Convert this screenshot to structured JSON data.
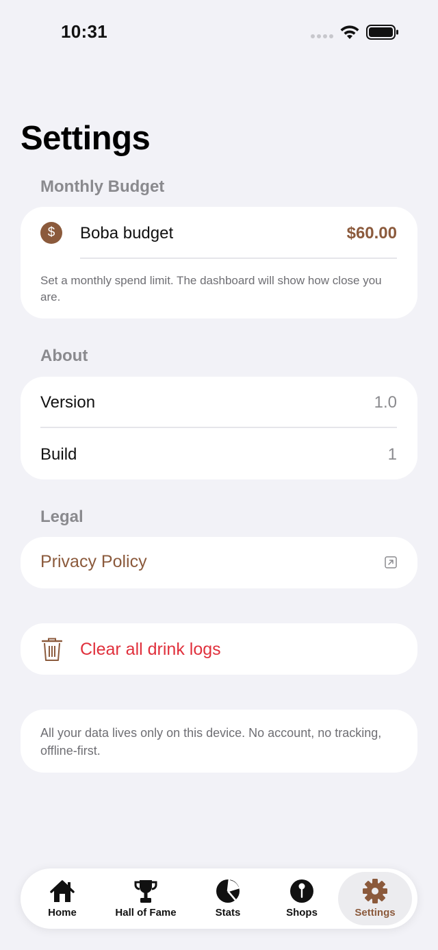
{
  "status_bar": {
    "time": "10:31"
  },
  "page": {
    "title": "Settings"
  },
  "monthly_budget": {
    "header": "Monthly Budget",
    "icon_glyph": "$",
    "label": "Boba budget",
    "value": "$60.00",
    "footnote": "Set a monthly spend limit. The dashboard will show how close you are."
  },
  "about": {
    "header": "About",
    "rows": [
      {
        "label": "Version",
        "value": "1.0"
      },
      {
        "label": "Build",
        "value": "1"
      }
    ]
  },
  "legal": {
    "header": "Legal",
    "privacy_label": "Privacy Policy"
  },
  "danger": {
    "clear_label": "Clear all drink logs"
  },
  "info": {
    "text": "All your data lives only on this device. No account, no tracking, offline-first."
  },
  "tabs": [
    {
      "label": "Home",
      "icon": "house-icon",
      "active": false
    },
    {
      "label": "Hall of Fame",
      "icon": "trophy-icon",
      "active": false
    },
    {
      "label": "Stats",
      "icon": "pie-chart-icon",
      "active": false
    },
    {
      "label": "Shops",
      "icon": "map-pin-icon",
      "active": false
    },
    {
      "label": "Settings",
      "icon": "gear-icon",
      "active": true
    }
  ],
  "colors": {
    "accent": "#8b5a3c",
    "danger": "#e0303c",
    "background": "#f2f2f7"
  }
}
